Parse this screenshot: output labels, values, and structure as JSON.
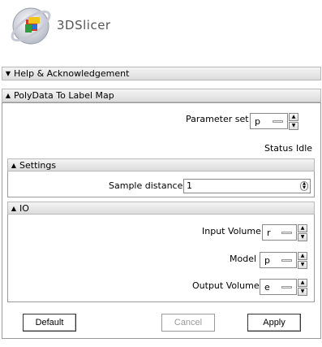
{
  "app": {
    "name": "3DSlicer"
  },
  "panels": {
    "help": {
      "title": "Help & Acknowledgement",
      "arrow": "▼"
    },
    "module": {
      "title": "PolyData To Label Map",
      "arrow": "▲"
    }
  },
  "parameter_set": {
    "label": "Parameter set",
    "value": "p"
  },
  "status": {
    "label": "Status",
    "value": "Idle"
  },
  "settings": {
    "title": "Settings",
    "arrow": "▲",
    "sample_distance_label": "Sample distance",
    "sample_distance_value": "1"
  },
  "io": {
    "title": "IO",
    "arrow": "▲",
    "input_volume_label": "Input Volume",
    "input_volume_value": "r",
    "model_label": "Model",
    "model_value": "p",
    "output_volume_label": "Output Volume",
    "output_volume_value": "e"
  },
  "buttons": {
    "default": "Default",
    "cancel": "Cancel",
    "apply": "Apply"
  },
  "icons": {
    "spin_up": "▲",
    "spin_down": "▼"
  }
}
